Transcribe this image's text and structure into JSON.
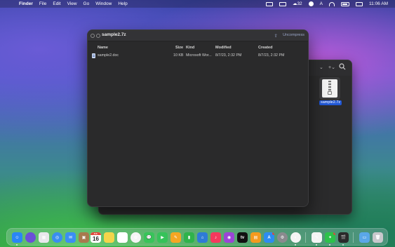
{
  "menubar": {
    "app_name": "Finder",
    "items": [
      "File",
      "Edit",
      "View",
      "Go",
      "Window",
      "Help"
    ],
    "temperature": "32",
    "input_indicator": "A",
    "time": "11:06 AM"
  },
  "archive_window": {
    "title": "sample2.7z",
    "uncompress_label": "Uncompress",
    "columns": {
      "name": "Name",
      "size": "Size",
      "kind": "Kind",
      "modified": "Modified",
      "created": "Created"
    },
    "rows": [
      {
        "name": "sample2.doc",
        "size": "10 KB",
        "kind": "Microsoft Wor...",
        "modified": "8/7/23, 2:32 PM",
        "created": "8/7/23, 2:32 PM"
      }
    ]
  },
  "finder_window": {
    "file_label": "sample2.7z"
  },
  "dock": {
    "calendar_month": "JUL",
    "calendar_day": "16",
    "apps": [
      {
        "name": "finder",
        "color": "#2a86f5"
      },
      {
        "name": "siri",
        "color": "#6b4fd8"
      },
      {
        "name": "launchpad",
        "color": "#e8e8ec"
      },
      {
        "name": "safari",
        "color": "#3a8ef0"
      },
      {
        "name": "mail",
        "color": "#3b8ef3"
      },
      {
        "name": "archive-utility",
        "color": "#a77a4e"
      },
      {
        "name": "contacts",
        "color": "#c79a6a"
      },
      {
        "name": "calendar",
        "color": "#ffffff"
      },
      {
        "name": "notes",
        "color": "#f3d54a"
      },
      {
        "name": "reminders",
        "color": "#ffffff"
      },
      {
        "name": "photos",
        "color": "#f4f4f4"
      },
      {
        "name": "messages",
        "color": "#38c45a"
      },
      {
        "name": "facetime",
        "color": "#36c25a"
      },
      {
        "name": "freeform",
        "color": "#f5a623"
      },
      {
        "name": "numbers",
        "color": "#2fb34b"
      },
      {
        "name": "keynote",
        "color": "#2e7bd6"
      },
      {
        "name": "music",
        "color": "#f5395d"
      },
      {
        "name": "podcasts",
        "color": "#9b45d6"
      },
      {
        "name": "apple-tv",
        "color": "#111111"
      },
      {
        "name": "books",
        "color": "#f39a1e"
      },
      {
        "name": "app-store",
        "color": "#2d8cf0"
      },
      {
        "name": "system-settings",
        "color": "#8a8a8e"
      },
      {
        "name": "chrome",
        "color": "#f4f4f4"
      },
      {
        "name": "textedit",
        "color": "#f4f4f4"
      },
      {
        "name": "wechat",
        "color": "#2dc24a"
      },
      {
        "name": "clapper",
        "color": "#2a2a2a"
      },
      {
        "name": "downloads-folder",
        "color": "#5aa7e8"
      },
      {
        "name": "trash",
        "color": "#c8c8cc"
      }
    ]
  }
}
